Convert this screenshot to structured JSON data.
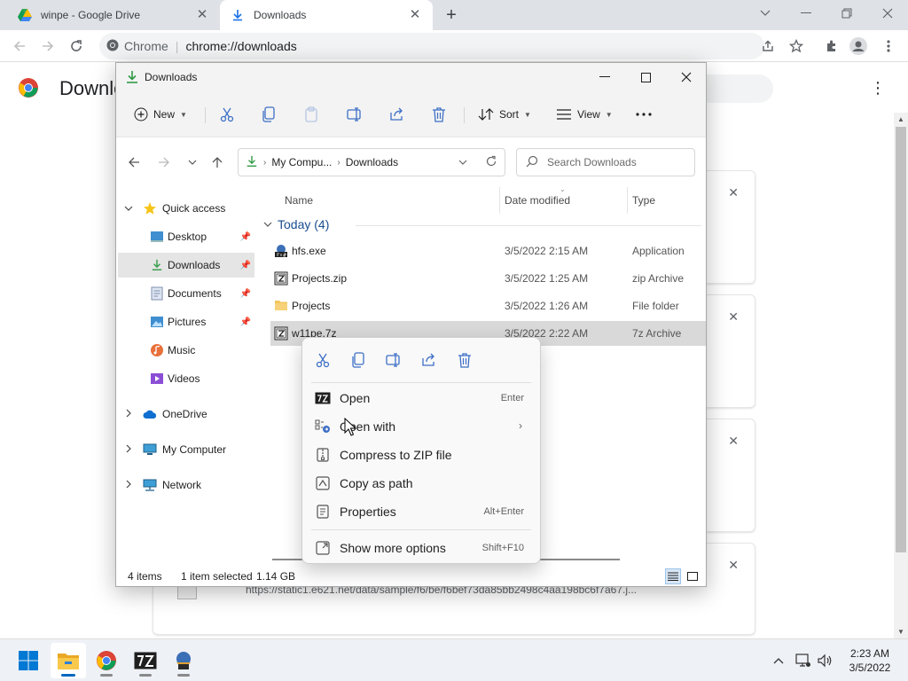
{
  "browser": {
    "tabs": [
      {
        "title": "winpe - Google Drive",
        "icon": "google-drive-icon"
      },
      {
        "title": "Downloads",
        "icon": "download-icon"
      }
    ],
    "omnibox": {
      "site_chip": "Chrome",
      "url": "chrome://downloads"
    }
  },
  "downloads_page": {
    "title": "Downloads",
    "partial_url": "https://static1.e621.net/data/sample/f6/be/f6bef73da85bb2498c4aa198bc6f7a67.j..."
  },
  "explorer": {
    "title": "Downloads",
    "command_bar": {
      "new_label": "New",
      "sort_label": "Sort",
      "view_label": "View"
    },
    "address": {
      "segments": [
        "My Compu...",
        "Downloads"
      ]
    },
    "search_placeholder": "Search Downloads",
    "nav": [
      {
        "label": "Quick access",
        "icon": "star-icon",
        "expand": "expanded"
      },
      {
        "label": "Desktop",
        "icon": "desktop-icon",
        "pinned": true
      },
      {
        "label": "Downloads",
        "icon": "download-icon",
        "pinned": true,
        "selected": true
      },
      {
        "label": "Documents",
        "icon": "documents-icon",
        "pinned": true
      },
      {
        "label": "Pictures",
        "icon": "pictures-icon",
        "pinned": true
      },
      {
        "label": "Music",
        "icon": "music-icon"
      },
      {
        "label": "Videos",
        "icon": "videos-icon"
      },
      {
        "label": "OneDrive",
        "icon": "cloud-icon",
        "expand": "collapsed"
      },
      {
        "label": "My Computer",
        "icon": "computer-icon",
        "expand": "collapsed"
      },
      {
        "label": "Network",
        "icon": "network-icon",
        "expand": "collapsed"
      }
    ],
    "columns": {
      "name": "Name",
      "date": "Date modified",
      "type": "Type"
    },
    "group": "Today (4)",
    "files": [
      {
        "name": "hfs.exe",
        "date": "3/5/2022 2:15 AM",
        "type": "Application",
        "icon": "exe-icon"
      },
      {
        "name": "Projects.zip",
        "date": "3/5/2022 1:25 AM",
        "type": "zip Archive",
        "icon": "archive-icon"
      },
      {
        "name": "Projects",
        "date": "3/5/2022 1:26 AM",
        "type": "File folder",
        "icon": "folder-icon"
      },
      {
        "name": "w11pe.7z",
        "date": "3/5/2022 2:22 AM",
        "type": "7z Archive",
        "icon": "archive-icon",
        "selected": true
      }
    ],
    "status": {
      "count": "4 items",
      "selected": "1 item selected",
      "size": "1.14 GB"
    }
  },
  "context_menu": {
    "items": [
      {
        "label": "Open",
        "shortcut": "Enter",
        "icon": "7zip-icon"
      },
      {
        "label": "Open with",
        "shortcut": "",
        "icon": "open-with-icon",
        "submenu": true
      },
      {
        "label": "Compress to ZIP file",
        "shortcut": "",
        "icon": "zip-icon"
      },
      {
        "label": "Copy as path",
        "shortcut": "",
        "icon": "copy-path-icon"
      },
      {
        "label": "Properties",
        "shortcut": "Alt+Enter",
        "icon": "properties-icon"
      },
      {
        "label": "Show more options",
        "shortcut": "Shift+F10",
        "icon": "more-options-icon"
      }
    ]
  },
  "taskbar": {
    "apps": [
      "windows-start-icon",
      "file-explorer-icon",
      "chrome-icon",
      "7zip-icon",
      "app-icon"
    ],
    "clock": {
      "time": "2:23 AM",
      "date": "3/5/2022"
    }
  },
  "colors": {
    "accent": "#0067c0",
    "chrome_frame": "#dee1e6",
    "folder": "#f2c55c"
  }
}
